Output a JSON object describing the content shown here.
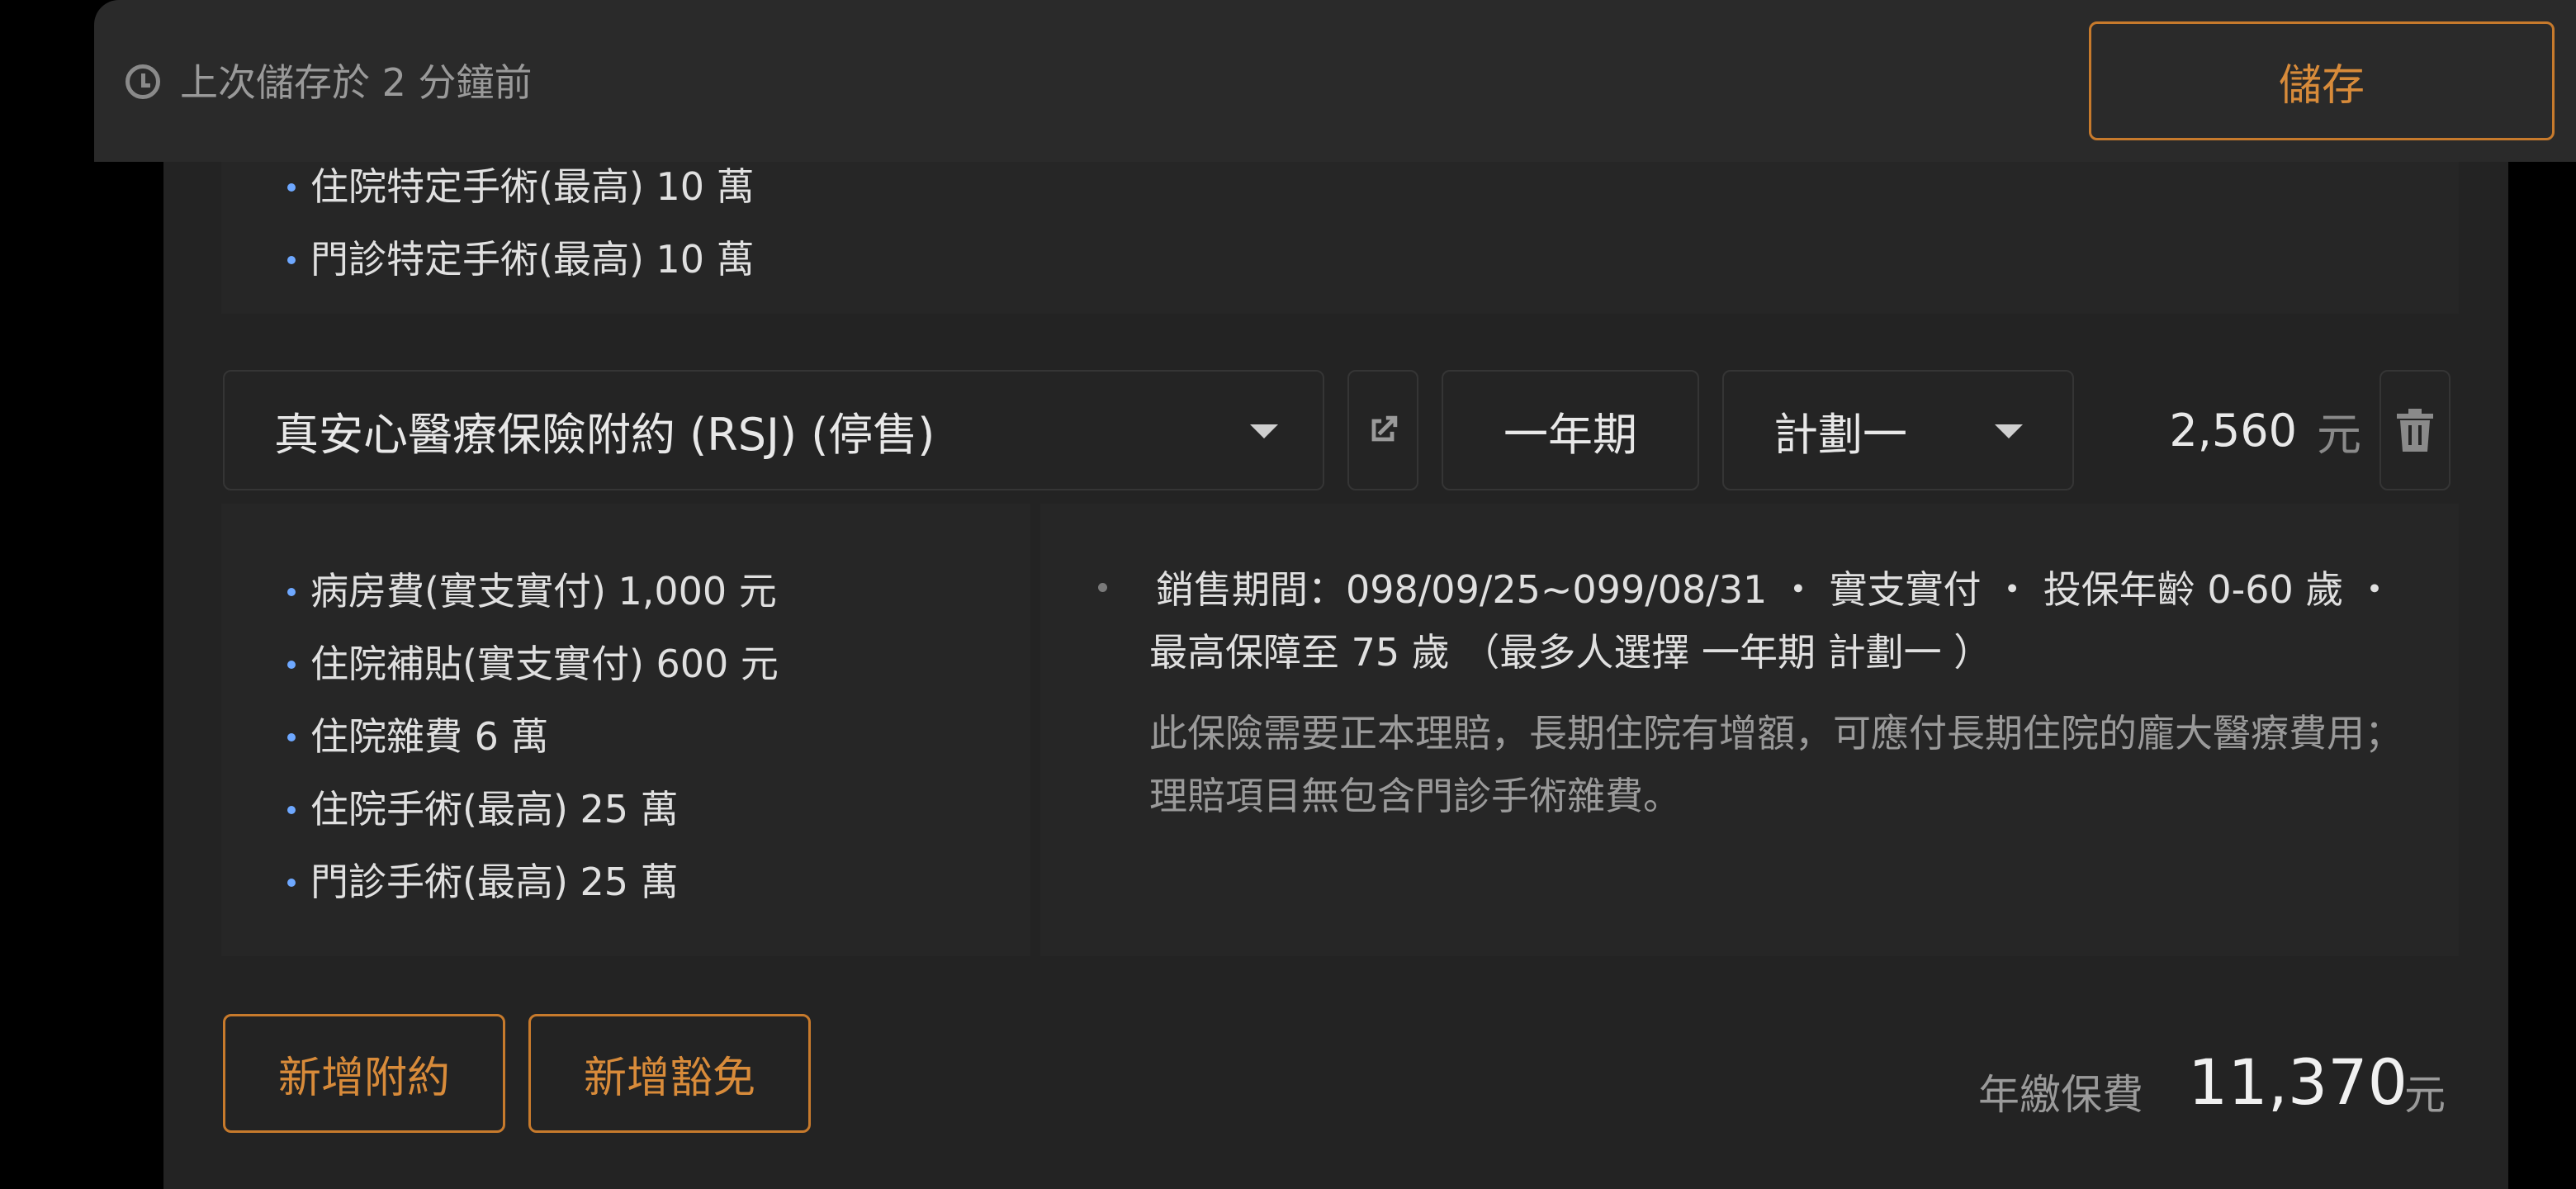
{
  "save_bar": {
    "last_saved": "上次儲存於 2 分鐘前",
    "save_label": "儲存",
    "accent_color": "#d88b3a"
  },
  "previous_rider": {
    "coverage": [
      "住院特定手術(最高) 10 萬",
      "門診特定手術(最高) 10 萬"
    ]
  },
  "rider": {
    "name": "真安心醫療保險附約 (RSJ) (停售)",
    "term": "一年期",
    "plan": "計劃一",
    "premium": "2,560",
    "premium_unit": "元",
    "coverage": [
      "病房費(實支實付) 1,000 元",
      "住院補貼(實支實付) 600 元",
      "住院雜費 6 萬",
      "住院手術(最高) 25 萬",
      "門診手術(最高) 25 萬"
    ],
    "info_line1": "銷售期間：098/09/25~099/08/31 ・ 實支實付 ・ 投保年齡 0-60 歲 ・",
    "info_line2": "最高保障至 75 歲 （最多人選擇 一年期 計劃一 ）",
    "note": "此保險需要正本理賠，長期住院有增額，可應付長期住院的龐大醫療費用；理賠項目無包含門診手術雜費。"
  },
  "actions": {
    "add_rider": "新增附約",
    "add_waiver": "新增豁免"
  },
  "total": {
    "label": "年繳保費",
    "value": "11,370",
    "unit": "元"
  },
  "icons": {
    "clock": "clock-icon",
    "external": "external-link-icon",
    "dropdown": "caret-down-icon",
    "trash": "trash-icon"
  }
}
